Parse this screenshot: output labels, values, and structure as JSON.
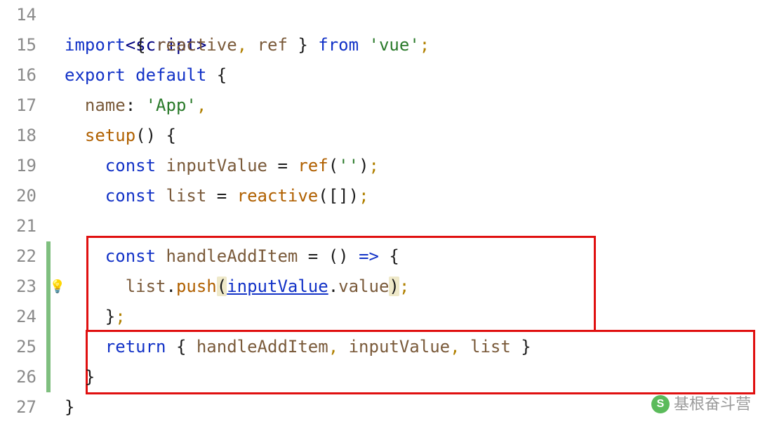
{
  "lines": [
    {
      "n": "14",
      "bar": false
    },
    {
      "n": "15",
      "bar": false
    },
    {
      "n": "16",
      "bar": false
    },
    {
      "n": "17",
      "bar": false
    },
    {
      "n": "18",
      "bar": false
    },
    {
      "n": "19",
      "bar": false
    },
    {
      "n": "20",
      "bar": false
    },
    {
      "n": "21",
      "bar": false
    },
    {
      "n": "22",
      "bar": true
    },
    {
      "n": "23",
      "bar": true,
      "bulb": true
    },
    {
      "n": "24",
      "bar": true
    },
    {
      "n": "25",
      "bar": true
    },
    {
      "n": "26",
      "bar": true
    },
    {
      "n": "27",
      "bar": false
    }
  ],
  "k": {
    "import": "import",
    "from": "from",
    "export": "export",
    "default": "default",
    "const": "const",
    "return": "return"
  },
  "tag": {
    "script_open": "<script>"
  },
  "id": {
    "reactive": "reactive",
    "ref": "ref",
    "name": "name",
    "setup": "setup",
    "inputValue": "inputValue",
    "list": "list",
    "handleAddItem": "handleAddItem",
    "push": "push",
    "value": "value"
  },
  "str": {
    "vue": "'vue'",
    "app": "'App'",
    "empty": "''"
  },
  "sym": {
    "lbrace": "{",
    "rbrace": "}",
    "lparen": "(",
    "rparen": ")",
    "comma": ",",
    "semi": ";",
    "colon": ":",
    "eq": "=",
    "arrow": "=>",
    "lbracket": "[",
    "rbracket": "]",
    "dot": "."
  },
  "watermark": {
    "icon": "S",
    "text": "基根奋斗营"
  }
}
